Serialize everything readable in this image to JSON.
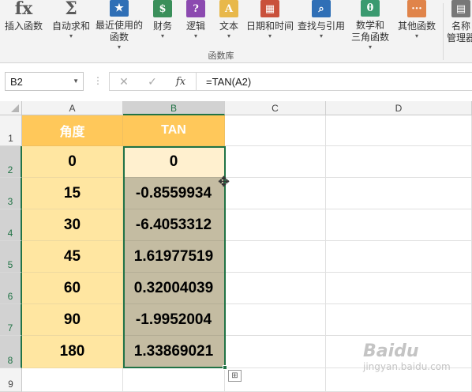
{
  "ribbon": {
    "buttons": [
      {
        "label": "插入函数",
        "icon": "fx-icon",
        "color": "#5a5a5a",
        "glyph": "fx",
        "dropdown": false
      },
      {
        "label": "自动求和",
        "icon": "sigma-icon",
        "color": "#5a5a5a",
        "glyph": "Σ",
        "dropdown": true
      },
      {
        "label": "最近使用的\n函数",
        "icon": "star-book-icon",
        "color": "#2f6fb6",
        "glyph": "★",
        "dropdown": true
      },
      {
        "label": "财务",
        "icon": "money-book-icon",
        "color": "#3a8f5a",
        "glyph": "$",
        "dropdown": true
      },
      {
        "label": "逻辑",
        "icon": "question-book-icon",
        "color": "#8c4ab0",
        "glyph": "?",
        "dropdown": true
      },
      {
        "label": "文本",
        "icon": "text-book-icon",
        "color": "#e8b84a",
        "glyph": "A",
        "dropdown": true
      },
      {
        "label": "日期和时间",
        "icon": "calendar-book-icon",
        "color": "#c9503b",
        "glyph": "▦",
        "dropdown": true
      },
      {
        "label": "查找与引用",
        "icon": "search-book-icon",
        "color": "#2f6fb6",
        "glyph": "⌕",
        "dropdown": true
      },
      {
        "label": "数学和\n三角函数",
        "icon": "theta-book-icon",
        "color": "#3a9a70",
        "glyph": "θ",
        "dropdown": true
      },
      {
        "label": "其他函数",
        "icon": "more-book-icon",
        "color": "#e0844a",
        "glyph": "···",
        "dropdown": true
      },
      {
        "label": "名称\n管理器",
        "icon": "name-manager-icon",
        "color": "#777777",
        "glyph": "▤",
        "dropdown": false
      }
    ],
    "group_label": "函数库"
  },
  "formula_bar": {
    "name_box": "B2",
    "cancel_glyph": "✕",
    "enter_glyph": "✓",
    "fx_glyph": "fx",
    "formula": "=TAN(A2)"
  },
  "grid": {
    "columns": [
      "A",
      "B",
      "C",
      "D"
    ],
    "rows": [
      "1",
      "2",
      "3",
      "4",
      "5",
      "6",
      "7",
      "8",
      "9"
    ],
    "header_row": [
      "角度",
      "TAN"
    ],
    "data": [
      [
        "0",
        "0"
      ],
      [
        "15",
        "-0.8559934"
      ],
      [
        "30",
        "-6.4053312"
      ],
      [
        "45",
        "1.61977519"
      ],
      [
        "60",
        "0.32004039"
      ],
      [
        "90",
        "-1.9952004"
      ],
      [
        "180",
        "1.33869021"
      ]
    ],
    "active_cell": "B2",
    "selection": "B2:B8"
  },
  "colors": {
    "header_fill": "#ffc85a",
    "col_a_fill": "#ffe6a1",
    "selected_fill": "#c4bca2",
    "active_fill": "#fff0cf",
    "accent": "#217346"
  },
  "watermark": {
    "big": "Baidu",
    "small": "jingyan.baidu.com"
  }
}
